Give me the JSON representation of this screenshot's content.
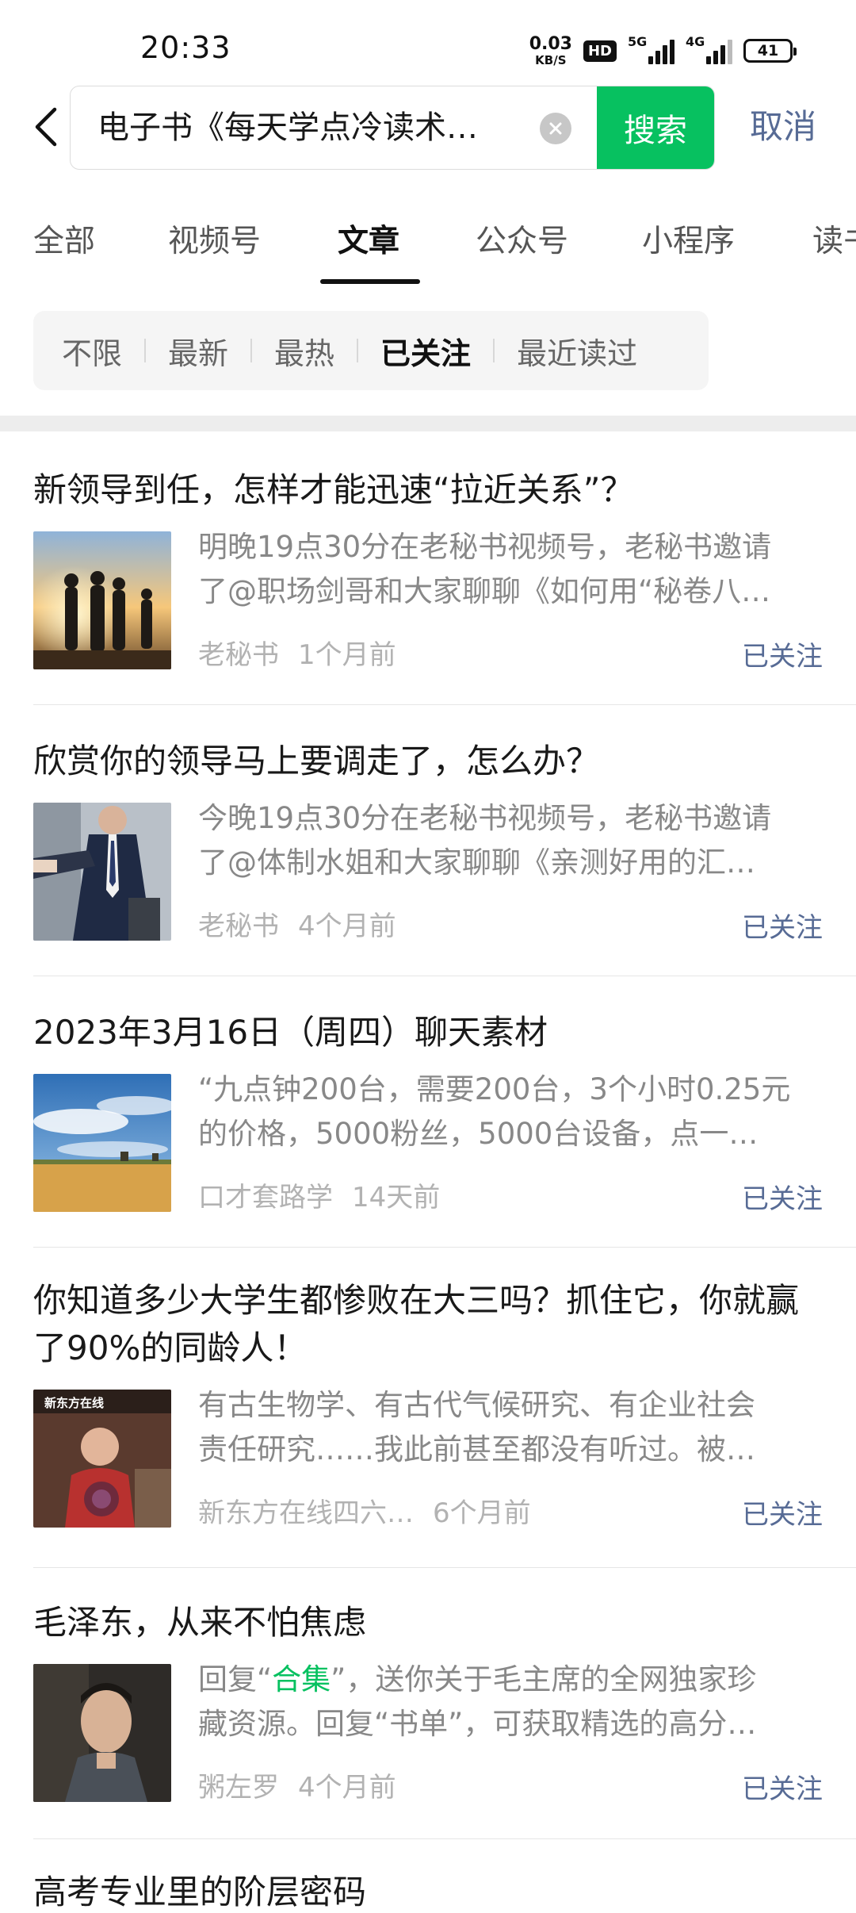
{
  "status_bar": {
    "time": "20:33",
    "net_speed": "0.03",
    "net_unit": "KB/S",
    "hd": "HD",
    "sig1_label": "5G",
    "sig2_label": "4G",
    "battery": "41"
  },
  "search": {
    "query": "电子书《每天学点冷读术…",
    "button": "搜索",
    "cancel": "取消"
  },
  "tabs": [
    "全部",
    "视频号",
    "文章",
    "公众号",
    "小程序",
    "读书"
  ],
  "active_tab": "文章",
  "filters": [
    "不限",
    "最新",
    "最热",
    "已关注",
    "最近读过"
  ],
  "active_filter": "已关注",
  "follow_label": "已关注",
  "articles": [
    {
      "title": "新领导到任，怎样才能迅速“拉近关系”？",
      "desc1": "明晚19点30分在老秘书视频号，老秘书邀请",
      "desc2": "了@职场剑哥和大家聊聊《如何用“秘卷八…",
      "source": "老秘书",
      "time": "1个月前"
    },
    {
      "title": "欣赏你的领导马上要调走了，怎么办？",
      "desc1": "今晚19点30分在老秘书视频号，老秘书邀请",
      "desc2": "了@体制水姐和大家聊聊《亲测好用的汇…",
      "source": "老秘书",
      "time": "4个月前"
    },
    {
      "title": "2023年3月16日（周四）聊天素材",
      "desc1": "“九点钟200台，需要200台，3个小时0.25元",
      "desc2": "的价格，5000粉丝，5000台设备，点一…",
      "source": "口才套路学",
      "time": "14天前"
    },
    {
      "title": "你知道多少大学生都惨败在大三吗？抓住它，你就赢了90%的同龄人！",
      "desc1": "有古生物学、有古代气候研究、有企业社会",
      "desc2": "责任研究……我此前甚至都没有听过。被…",
      "source": "新东方在线四六…",
      "time": "6个月前",
      "thumb_label": "新东方在线"
    },
    {
      "title": "毛泽东，从来不怕焦虑",
      "desc1_pre": "回复“",
      "desc1_hl": "合集",
      "desc1_post": "”，送你关于毛主席的全网独家珍",
      "desc2": "藏资源。回复“书单”，可获取精选的高分…",
      "source": "粥左罗",
      "time": "4个月前"
    },
    {
      "title": "高考专业里的阶层密码"
    }
  ]
}
